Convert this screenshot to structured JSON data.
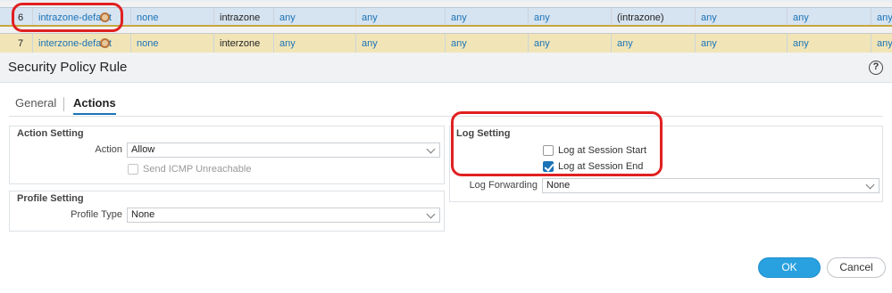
{
  "policy_table": {
    "rows": [
      {
        "index": "6",
        "name": "intrazone-default",
        "tags": "none",
        "type": "intrazone",
        "source_zone": "any",
        "source_address": "any",
        "source_user": "any",
        "source_device": "any",
        "destination_zone": "(intrazone)",
        "destination_address": "any",
        "destination_device": "any",
        "application": "any"
      },
      {
        "index": "7",
        "name": "interzone-default",
        "tags": "none",
        "type": "interzone",
        "source_zone": "any",
        "source_address": "any",
        "source_user": "any",
        "source_device": "any",
        "destination_zone": "any",
        "destination_address": "any",
        "destination_device": "any",
        "application": "any"
      }
    ]
  },
  "dialog": {
    "title": "Security Policy Rule",
    "help_icon": "?",
    "tabs": [
      {
        "label": "General",
        "active": false
      },
      {
        "label": "Actions",
        "active": true
      }
    ],
    "action_setting": {
      "title": "Action Setting",
      "action_label": "Action",
      "action_value": "Allow",
      "send_icmp_label": "Send ICMP Unreachable",
      "send_icmp_checked": false,
      "send_icmp_disabled": true
    },
    "profile_setting": {
      "title": "Profile Setting",
      "profile_type_label": "Profile Type",
      "profile_type_value": "None"
    },
    "log_setting": {
      "title": "Log Setting",
      "log_start_label": "Log at Session Start",
      "log_start_checked": false,
      "log_end_label": "Log at Session End",
      "log_end_checked": true,
      "log_forwarding_label": "Log Forwarding",
      "log_forwarding_value": "None"
    },
    "buttons": {
      "ok_label": "OK",
      "cancel_label": "Cancel"
    }
  },
  "colors": {
    "accent": "#29a1e0",
    "link": "#1a73b8",
    "callout": "#e02020",
    "selected_row": "#d6e3f0",
    "default_row": "#f1e5b8"
  },
  "icons": [
    "gear-icon",
    "help-icon",
    "chevron-down-icon",
    "checkbox-icon"
  ]
}
